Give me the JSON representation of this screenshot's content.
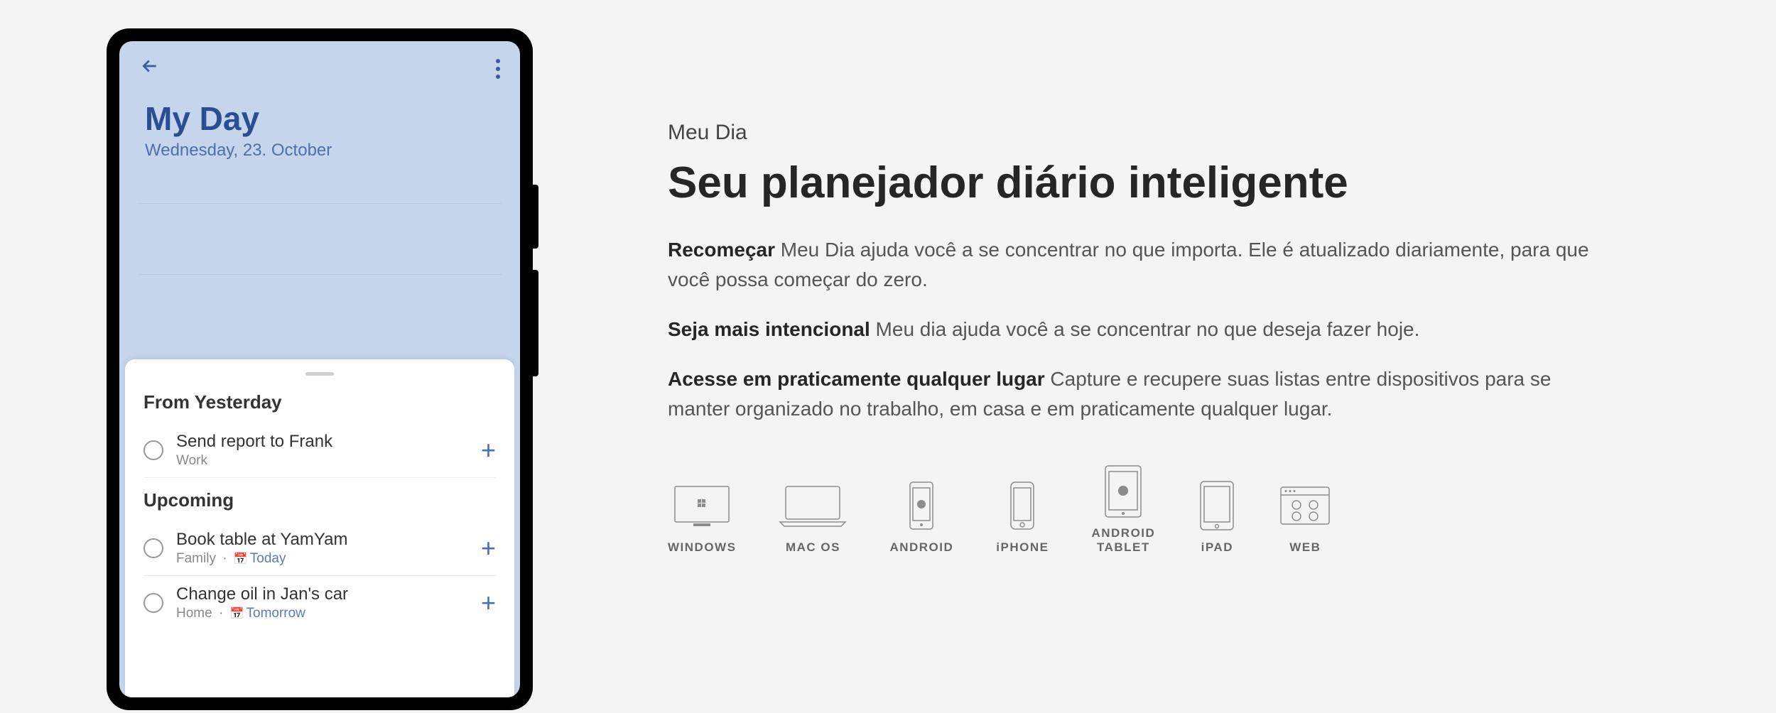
{
  "phone": {
    "title": "My Day",
    "date": "Wednesday, 23. October",
    "sections": [
      {
        "header": "From Yesterday",
        "tasks": [
          {
            "title": "Send report to Frank",
            "category": "Work",
            "due": ""
          }
        ]
      },
      {
        "header": "Upcoming",
        "tasks": [
          {
            "title": "Book table at YamYam",
            "category": "Family",
            "due": "Today"
          },
          {
            "title": "Change oil in Jan's car",
            "category": "Home",
            "due": "Tomorrow"
          }
        ]
      }
    ]
  },
  "content": {
    "eyebrow": "Meu Dia",
    "headline": "Seu planejador diário inteligente",
    "paragraphs": [
      {
        "lead": "Recomeçar",
        "body": " Meu Dia ajuda você a se concentrar no que importa. Ele é atualizado diariamente, para que você possa começar do zero."
      },
      {
        "lead": "Seja mais intencional",
        "body": " Meu dia ajuda você a se concentrar no que deseja fazer hoje."
      },
      {
        "lead": "Acesse em praticamente qualquer lugar",
        "body": " Capture e recupere suas listas entre dispositivos para se manter organizado no trabalho, em casa e em praticamente qualquer lugar."
      }
    ],
    "platforms": [
      {
        "label": "WINDOWS",
        "icon": "windows"
      },
      {
        "label": "MAC OS",
        "icon": "macos"
      },
      {
        "label": "ANDROID",
        "icon": "android-phone"
      },
      {
        "label": "iPHONE",
        "icon": "iphone"
      },
      {
        "label": "ANDROID\nTABLET",
        "icon": "android-tablet"
      },
      {
        "label": "iPAD",
        "icon": "ipad"
      },
      {
        "label": "WEB",
        "icon": "web"
      }
    ]
  }
}
